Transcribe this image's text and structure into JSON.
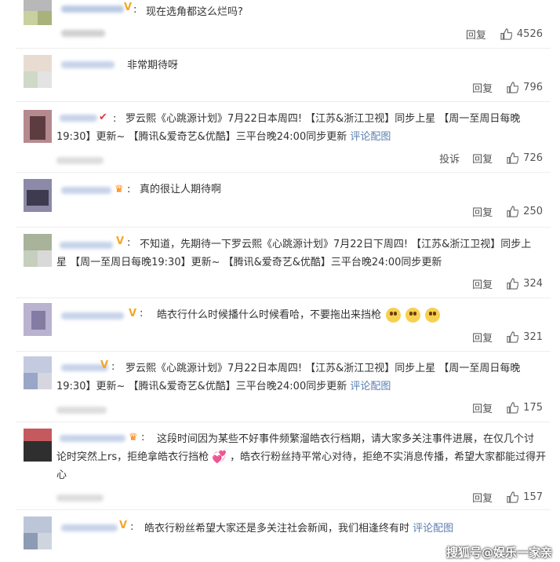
{
  "comments": [
    {
      "text": "现在选角都这么烂吗?",
      "reply": "回复",
      "likes": "4526"
    },
    {
      "text": "非常期待呀",
      "reply": "回复",
      "likes": "796"
    },
    {
      "text_a": "罗云熙《心跳源计划》7月22日本周四!  【江苏&浙江卫视】同步上星  【周一至周日每晚",
      "text_b": "19:30】更新~  【腾讯&爱奇艺&优酷】三平台晚24:00同步更新",
      "link": "评论配图",
      "report": "投诉",
      "reply": "回复",
      "likes": "726"
    },
    {
      "text": "真的很让人期待啊",
      "reply": "回复",
      "likes": "250"
    },
    {
      "text_a": "不知道，先期待一下罗云熙《心跳源计划》7月22日下周四!  【江苏&浙江卫视】同步上",
      "text_b": "星  【周一至周日每晚19:30】更新~  【腾讯&爱奇艺&优酷】三平台晚24:00同步更新",
      "reply": "回复",
      "likes": "324"
    },
    {
      "text": "皓衣行什么时候播什么时候看哈，不要拖出来挡枪",
      "reply": "回复",
      "likes": "321"
    },
    {
      "text_a": "罗云熙《心跳源计划》7月22日本周四!  【江苏&浙江卫视】同步上星  【周一至周日每晚",
      "text_b": "19:30】更新~  【腾讯&爱奇艺&优酷】三平台晚24:00同步更新",
      "link": "评论配图",
      "reply": "回复",
      "likes": "175"
    },
    {
      "text_a": "这段时间因为某些不好事件频繁溜皓衣行档期，请大家多关注事件进展，在仅几个讨",
      "text_b": "论时突然上rs，拒绝拿皓衣行挡枪",
      "text_b2": "，皓衣行粉丝持平常心对待，拒绝不实消息传播，希望大家都能过得开",
      "text_c": "心",
      "reply": "回复",
      "likes": "157"
    },
    {
      "text": "皓衣行粉丝希望大家还是多关注社会新闻，我们相逢终有时",
      "link": "评论配图"
    }
  ],
  "watermark": "搜狐号@娱乐一家亲"
}
